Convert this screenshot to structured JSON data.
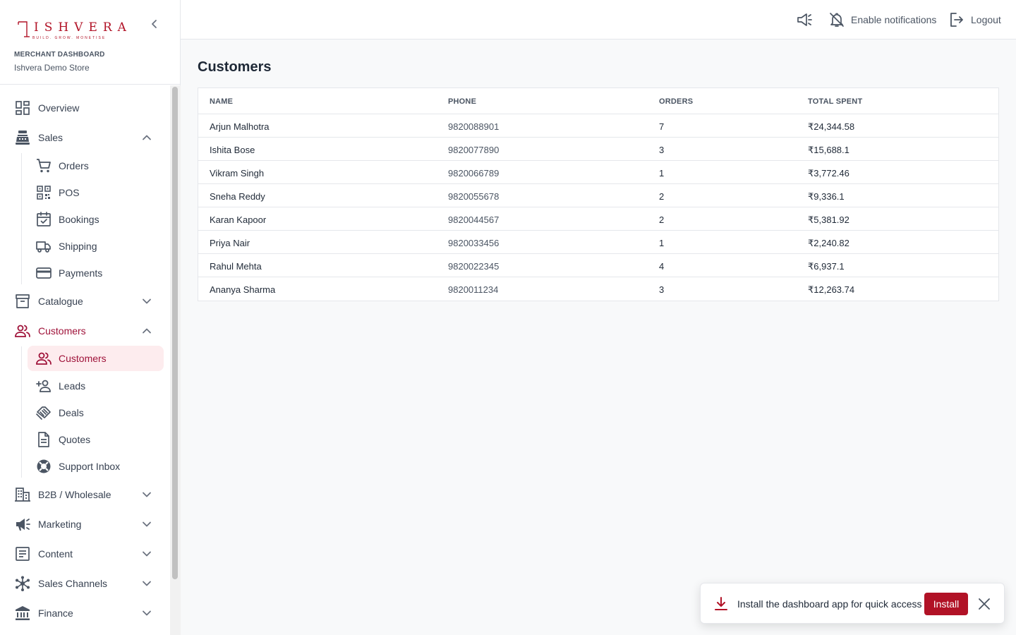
{
  "brand": {
    "logo_text": "ISHVERA",
    "logo_tagline": "BUILD. GROW. MONETISE",
    "caption": "MERCHANT DASHBOARD",
    "store": "Ishvera Demo Store"
  },
  "sidebar": {
    "items": [
      {
        "label": "Overview",
        "icon": "dashboard-icon"
      },
      {
        "label": "Sales",
        "icon": "cash-register-icon",
        "expanded": true,
        "children": [
          {
            "label": "Orders",
            "icon": "cart-icon"
          },
          {
            "label": "POS",
            "icon": "qr-code-icon"
          },
          {
            "label": "Bookings",
            "icon": "calendar-check-icon"
          },
          {
            "label": "Shipping",
            "icon": "truck-icon"
          },
          {
            "label": "Payments",
            "icon": "credit-card-icon"
          }
        ]
      },
      {
        "label": "Catalogue",
        "icon": "archive-icon",
        "expanded": false
      },
      {
        "label": "Customers",
        "icon": "people-icon",
        "expanded": true,
        "active": true,
        "children": [
          {
            "label": "Customers",
            "icon": "people-icon",
            "selected": true
          },
          {
            "label": "Leads",
            "icon": "person-add-icon"
          },
          {
            "label": "Deals",
            "icon": "handshake-icon"
          },
          {
            "label": "Quotes",
            "icon": "document-icon"
          },
          {
            "label": "Support Inbox",
            "icon": "lifebuoy-icon"
          }
        ]
      },
      {
        "label": "B2B / Wholesale",
        "icon": "building-icon",
        "expanded": false
      },
      {
        "label": "Marketing",
        "icon": "megaphone-icon",
        "expanded": false
      },
      {
        "label": "Content",
        "icon": "article-icon",
        "expanded": false
      },
      {
        "label": "Sales Channels",
        "icon": "hub-icon",
        "expanded": false
      },
      {
        "label": "Finance",
        "icon": "bank-icon",
        "expanded": false
      }
    ]
  },
  "topbar": {
    "announcements_icon": "megaphone-icon",
    "notifications_label": "Enable notifications",
    "logout_label": "Logout"
  },
  "main": {
    "title": "Customers",
    "columns": [
      "NAME",
      "PHONE",
      "ORDERS",
      "TOTAL SPENT"
    ],
    "rows": [
      [
        "Arjun Malhotra",
        "9820088901",
        "7",
        "₹24,344.58"
      ],
      [
        "Ishita Bose",
        "9820077890",
        "3",
        "₹15,688.1"
      ],
      [
        "Vikram Singh",
        "9820066789",
        "1",
        "₹3,772.46"
      ],
      [
        "Sneha Reddy",
        "9820055678",
        "2",
        "₹9,336.1"
      ],
      [
        "Karan Kapoor",
        "9820044567",
        "2",
        "₹5,381.92"
      ],
      [
        "Priya Nair",
        "9820033456",
        "1",
        "₹2,240.82"
      ],
      [
        "Rahul Mehta",
        "9820022345",
        "4",
        "₹6,937.1"
      ],
      [
        "Ananya Sharma",
        "9820011234",
        "3",
        "₹12,263.74"
      ]
    ]
  },
  "install_toast": {
    "message": "Install the dashboard app for quick access",
    "button_label": "Install"
  },
  "colors": {
    "accent": "#b11226",
    "active_text": "#9f1239",
    "selected_bg": "#fdecee"
  }
}
